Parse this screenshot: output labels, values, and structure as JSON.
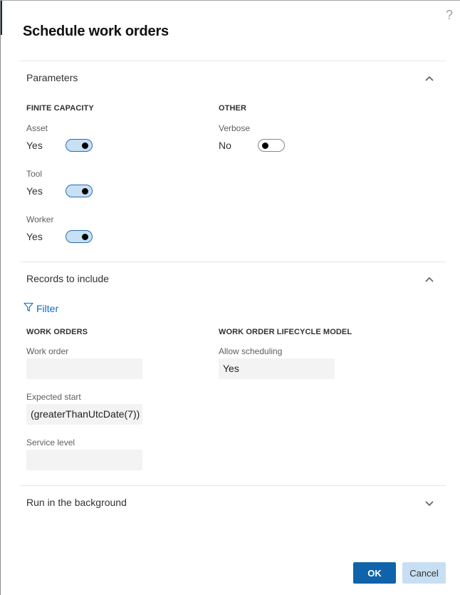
{
  "dialog": {
    "title": "Schedule work orders",
    "help_label": "?"
  },
  "sections": {
    "parameters": {
      "title": "Parameters",
      "expanded": true,
      "finite_capacity": {
        "title": "FINITE CAPACITY",
        "items": [
          {
            "label": "Asset",
            "value": "Yes",
            "on": true
          },
          {
            "label": "Tool",
            "value": "Yes",
            "on": true
          },
          {
            "label": "Worker",
            "value": "Yes",
            "on": true
          }
        ]
      },
      "other": {
        "title": "OTHER",
        "items": [
          {
            "label": "Verbose",
            "value": "No",
            "on": false
          }
        ]
      }
    },
    "records": {
      "title": "Records to include",
      "expanded": true,
      "filter_label": "Filter",
      "work_orders": {
        "title": "WORK ORDERS",
        "fields": [
          {
            "label": "Work order",
            "value": ""
          },
          {
            "label": "Expected start",
            "value": "(greaterThanUtcDate(7))"
          },
          {
            "label": "Service level",
            "value": ""
          }
        ]
      },
      "lifecycle": {
        "title": "WORK ORDER LIFECYCLE MODEL",
        "fields": [
          {
            "label": "Allow scheduling",
            "value": "Yes"
          }
        ]
      }
    },
    "background": {
      "title": "Run in the background",
      "expanded": false
    }
  },
  "buttons": {
    "ok": "OK",
    "cancel": "Cancel"
  },
  "colors": {
    "primary": "#0f63aa",
    "secondary": "#c7dff3",
    "toggle_on_fill": "#c7e0f4",
    "link": "#0f6cbd"
  }
}
